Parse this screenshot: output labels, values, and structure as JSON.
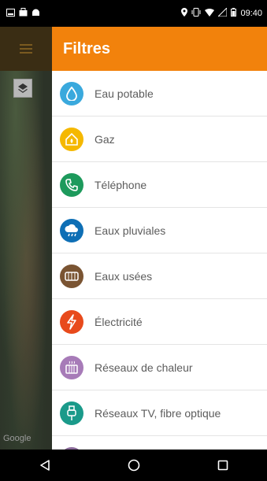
{
  "status_bar": {
    "left_icons": [
      "screenshot-icon",
      "bag-icon",
      "android-icon"
    ],
    "right_icons": [
      "location-icon",
      "vibrate-icon",
      "wifi-icon",
      "signal-icon",
      "battery-icon"
    ],
    "time": "09:40"
  },
  "map": {
    "attribution": "Google"
  },
  "drawer": {
    "title": "Filtres",
    "items": [
      {
        "label": "Eau potable",
        "icon": "water-drop-icon",
        "color": "#3aa9dd"
      },
      {
        "label": "Gaz",
        "icon": "gas-house-icon",
        "color": "#f5b800"
      },
      {
        "label": "Téléphone",
        "icon": "phone-icon",
        "color": "#1d9a5c"
      },
      {
        "label": "Eaux pluviales",
        "icon": "rain-cloud-icon",
        "color": "#0e6fb5"
      },
      {
        "label": "Eaux usées",
        "icon": "sewer-icon",
        "color": "#7a5432"
      },
      {
        "label": "Électricité",
        "icon": "lightning-icon",
        "color": "#e84a1c"
      },
      {
        "label": "Réseaux de chaleur",
        "icon": "heat-network-icon",
        "color": "#a77bb8"
      },
      {
        "label": "Réseaux TV, fibre optique",
        "icon": "fiber-plug-icon",
        "color": "#1a9a8a"
      },
      {
        "label": "",
        "icon": "partial-item-icon",
        "color": "#8a6a9a"
      }
    ]
  },
  "nav_bar": {
    "buttons": [
      "back-icon",
      "home-icon",
      "recents-icon"
    ]
  }
}
